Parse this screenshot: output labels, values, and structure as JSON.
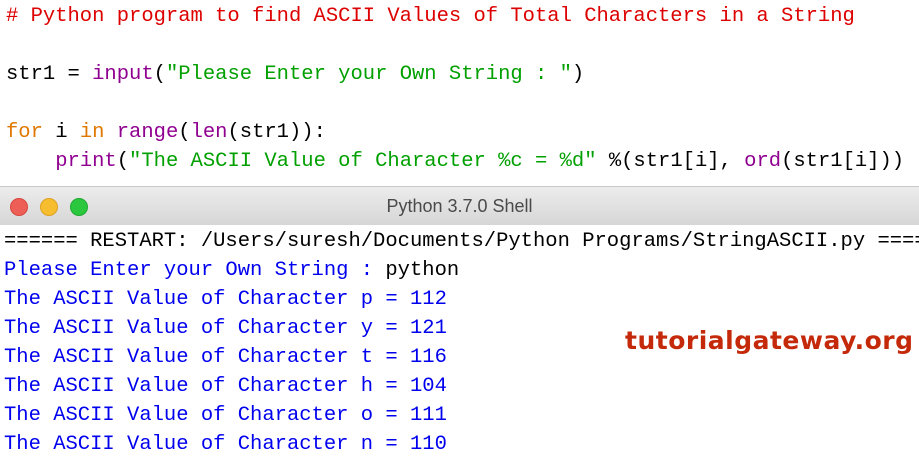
{
  "editor": {
    "comment": "# Python program to find ASCII Values of Total Characters in a String",
    "line2": {
      "var": "str1 = ",
      "fn": "input",
      "open": "(",
      "str": "\"Please Enter your Own String : \"",
      "close": ")"
    },
    "line3": {
      "kw1": "for",
      "mid1": " i ",
      "kw2": "in",
      "sp": " ",
      "fn1": "range",
      "p1": "(",
      "fn2": "len",
      "rest": "(str1)):"
    },
    "line4": {
      "indent": "    ",
      "fn": "print",
      "open": "(",
      "str": "\"The ASCII Value of Character %c = %d\"",
      "mid": " %(str1[i], ",
      "fn2": "ord",
      "end": "(str1[i]))"
    }
  },
  "shell": {
    "title": "Python 3.7.0 Shell",
    "restart": "====== RESTART: /Users/suresh/Documents/Python Programs/StringASCII.py ======",
    "prompt": "Please Enter your Own String : ",
    "input": "python",
    "outputs": [
      "The ASCII Value of Character p = 112",
      "The ASCII Value of Character y = 121",
      "The ASCII Value of Character t = 116",
      "The ASCII Value of Character h = 104",
      "The ASCII Value of Character o = 111",
      "The ASCII Value of Character n = 110"
    ]
  },
  "watermark": "tutorialgateway.org",
  "colors": {
    "keyword": "#e07800",
    "builtin": "#900090",
    "string": "#00a000",
    "comment": "#dd0000",
    "output": "#0000ee"
  }
}
